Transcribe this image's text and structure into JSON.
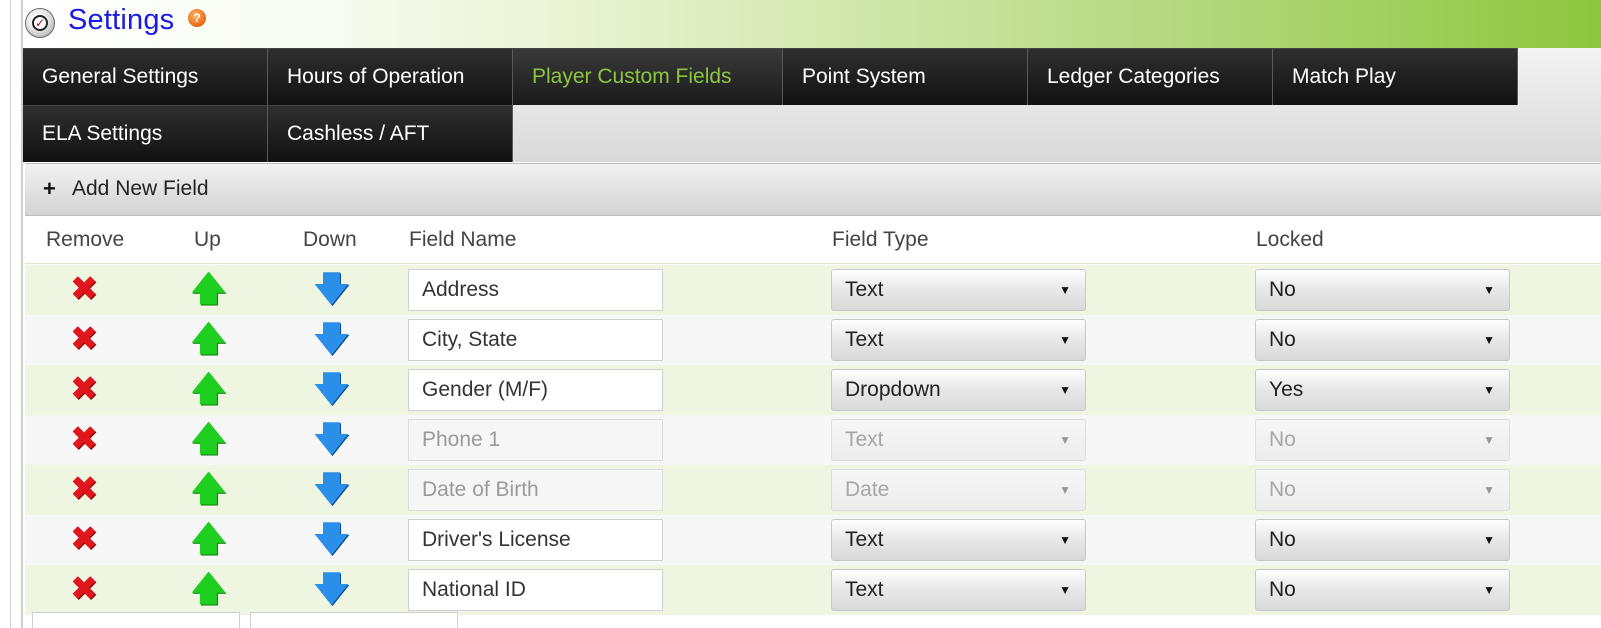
{
  "header": {
    "title": "Settings",
    "help_glyph": "?",
    "logo_glyph": "✓"
  },
  "tabs": [
    {
      "label": "General Settings",
      "active": false
    },
    {
      "label": "Hours of Operation",
      "active": false
    },
    {
      "label": "Player Custom Fields",
      "active": true
    },
    {
      "label": "Point System",
      "active": false
    },
    {
      "label": "Ledger Categories",
      "active": false
    },
    {
      "label": "Match Play",
      "active": false
    },
    {
      "label": "ELA Settings",
      "active": false
    },
    {
      "label": "Cashless / AFT",
      "active": false
    }
  ],
  "toolbar": {
    "add_icon": "+",
    "add_label": "Add New Field"
  },
  "columns": {
    "remove": "Remove",
    "up": "Up",
    "down": "Down",
    "field_name": "Field Name",
    "field_type": "Field Type",
    "locked": "Locked"
  },
  "icons": {
    "remove": "remove-icon",
    "up": "arrow-up-icon",
    "down": "arrow-down-icon"
  },
  "colors": {
    "accent": "#8cc63f",
    "title": "#1a1ae6",
    "remove": "#e0161c",
    "up": "#1fcf1f",
    "down": "#2a8fe8"
  },
  "rows": [
    {
      "name": "Address",
      "type": "Text",
      "locked": "No",
      "disabled": false
    },
    {
      "name": "City, State",
      "type": "Text",
      "locked": "No",
      "disabled": false
    },
    {
      "name": "Gender (M/F)",
      "type": "Dropdown",
      "locked": "Yes",
      "disabled": false
    },
    {
      "name": "Phone 1",
      "type": "Text",
      "locked": "No",
      "disabled": true
    },
    {
      "name": "Date of Birth",
      "type": "Date",
      "locked": "No",
      "disabled": true
    },
    {
      "name": "Driver's License",
      "type": "Text",
      "locked": "No",
      "disabled": false
    },
    {
      "name": "National ID",
      "type": "Text",
      "locked": "No",
      "disabled": false
    }
  ]
}
